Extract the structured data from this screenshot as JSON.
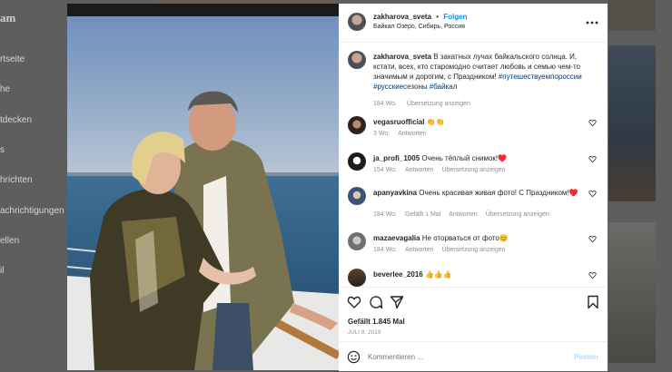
{
  "background": {
    "logo": "am",
    "nav_items": [
      "rtseite",
      "he",
      "tdecken",
      "s",
      "hrichten",
      "achrichtigungen",
      "ellen",
      "il"
    ]
  },
  "post": {
    "author": {
      "username": "zakharova_sveta",
      "follow_label": "Folgen",
      "follow_sep": "•",
      "location": "Байкал Озеро, Сибирь, Россия"
    },
    "caption": {
      "username": "zakharova_sveta",
      "text": "В закатных лучах байкальского солнца. И, кстати, всех, кто старомодно считает любовь и семью чем-то значимым и дорогим, с Праздником!",
      "hashtags": "#путешествуемпороссии #русскиесезоны #байкал",
      "time": "184 Wo.",
      "translate": "Übersetzung anzeigen"
    },
    "comments": [
      {
        "username": "vegasruofficial",
        "text": "👏👏",
        "time": "3 Wo.",
        "meta": [
          "Antworten"
        ]
      },
      {
        "username": "ja_profi_1005",
        "text": "Очень тёплый снимок!♥️",
        "time": "154 Wo.",
        "meta": [
          "Antworten",
          "Übersetzung anzeigen"
        ]
      },
      {
        "username": "apanyavkina",
        "text": "Очень красивая живая фото! С Праздником!♥️",
        "time": "184 Wo.",
        "meta": [
          "Gefällt 1 Mal",
          "Antworten",
          "Übersetzung anzeigen"
        ]
      },
      {
        "username": "mazaevagalia",
        "text": "Не оторваться от фото😊",
        "time": "184 Wo.",
        "meta": [
          "Antworten",
          "Übersetzung anzeigen"
        ]
      },
      {
        "username": "beverlee_2016",
        "text": "👍👍👍",
        "time": "",
        "meta": []
      }
    ],
    "likes": "Gefällt 1.845 Mal",
    "date": "JULI 8, 2019",
    "add_comment": {
      "placeholder": "Kommentieren ...",
      "post_label": "Posten"
    },
    "colors": {
      "link": "#00376b",
      "follow": "#0095f6",
      "heart": "#ed4956"
    },
    "icons": [
      "more-options-icon",
      "heart-icon",
      "comment-icon",
      "share-icon",
      "bookmark-icon",
      "emoji-icon"
    ]
  }
}
